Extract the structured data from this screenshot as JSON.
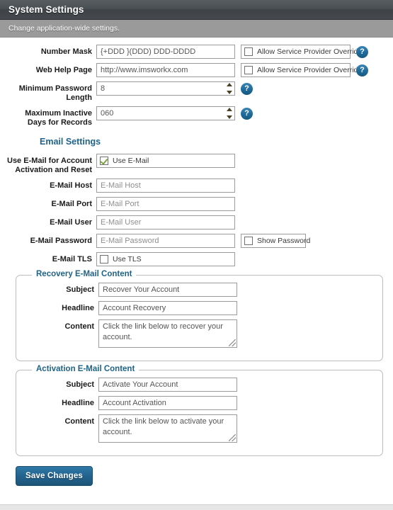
{
  "header": {
    "title": "System Settings",
    "subtitle": "Change application-wide settings."
  },
  "general": {
    "number_mask": {
      "label": "Number Mask",
      "value": "{+DDD }(DDD) DDD-DDDD",
      "override_label": "Allow Service Provider Override",
      "override_checked": false,
      "help_icon": "help-icon",
      "help_glyph": "?"
    },
    "web_help_page": {
      "label": "Web Help Page",
      "value": "http://www.imsworkx.com",
      "override_label": "Allow Service Provider Override",
      "override_checked": false,
      "help_glyph": "?"
    },
    "min_password_length": {
      "label": "Minimum Password Length",
      "value": "8",
      "help_glyph": "?"
    },
    "max_inactive_days": {
      "label": "Maximum Inactive Days for Records",
      "value": "060",
      "help_glyph": "?"
    }
  },
  "email_settings": {
    "heading": "Email Settings",
    "use_email": {
      "label": "Use E-Mail for Account Activation and Reset",
      "checkbox_label": "Use E-Mail",
      "checked": true
    },
    "host": {
      "label": "E-Mail Host",
      "value": "",
      "placeholder": "E-Mail Host"
    },
    "port": {
      "label": "E-Mail Port",
      "value": "",
      "placeholder": "E-Mail Port"
    },
    "user": {
      "label": "E-Mail User",
      "value": "",
      "placeholder": "E-Mail User"
    },
    "password": {
      "label": "E-Mail Password",
      "value": "",
      "placeholder": "E-Mail Password",
      "show_password_label": "Show Password",
      "show_password_checked": false
    },
    "tls": {
      "label": "E-Mail TLS",
      "checkbox_label": "Use TLS",
      "checked": false
    }
  },
  "recovery_email": {
    "legend": "Recovery E-Mail Content",
    "subject": {
      "label": "Subject",
      "value": "Recover Your Account"
    },
    "headline": {
      "label": "Headline",
      "value": "Account Recovery"
    },
    "content": {
      "label": "Content",
      "value": "Click the link below to recover your account."
    }
  },
  "activation_email": {
    "legend": "Activation E-Mail Content",
    "subject": {
      "label": "Subject",
      "value": "Activate Your Account"
    },
    "headline": {
      "label": "Headline",
      "value": "Account Activation"
    },
    "content": {
      "label": "Content",
      "value": "Click the link below to activate your account."
    }
  },
  "actions": {
    "save_label": "Save Changes"
  },
  "colors": {
    "accent_blue": "#1f6389",
    "help_blue": "#1f6a9a",
    "check_green": "#7aa43c",
    "titlebar": "#45494d",
    "subbar": "#9a9a9a"
  }
}
